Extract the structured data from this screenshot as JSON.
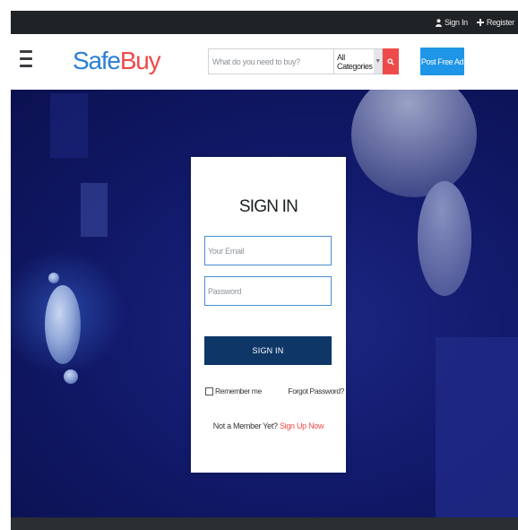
{
  "topbar": {
    "sign_in": "Sign In",
    "register": "Register",
    "icons": [
      "user-icon",
      "plus-icon"
    ]
  },
  "header": {
    "logo": {
      "part1": "Safe",
      "part2": "Buy"
    },
    "search": {
      "placeholder": "What do you need to buy?",
      "category_selected": "All Categories",
      "search_icon": "search-icon"
    },
    "post_ad_label": "Post Free Ad"
  },
  "login": {
    "title": "SIGN IN",
    "email_placeholder": "Your Email",
    "password_placeholder": "Password",
    "button_label": "SIGN IN",
    "remember_label": "Remember me",
    "forgot_label": "Forgot Password?",
    "member_prompt": "Not a Member Yet?",
    "signup_link": "Sign Up Now"
  },
  "colors": {
    "logo_blue": "#2a7fd6",
    "logo_red": "#ef4a4a",
    "post_ad_blue": "#1e95e6",
    "signin_button": "#0e3768",
    "hero_background": "#121a6c",
    "topbar": "#1f2326"
  }
}
